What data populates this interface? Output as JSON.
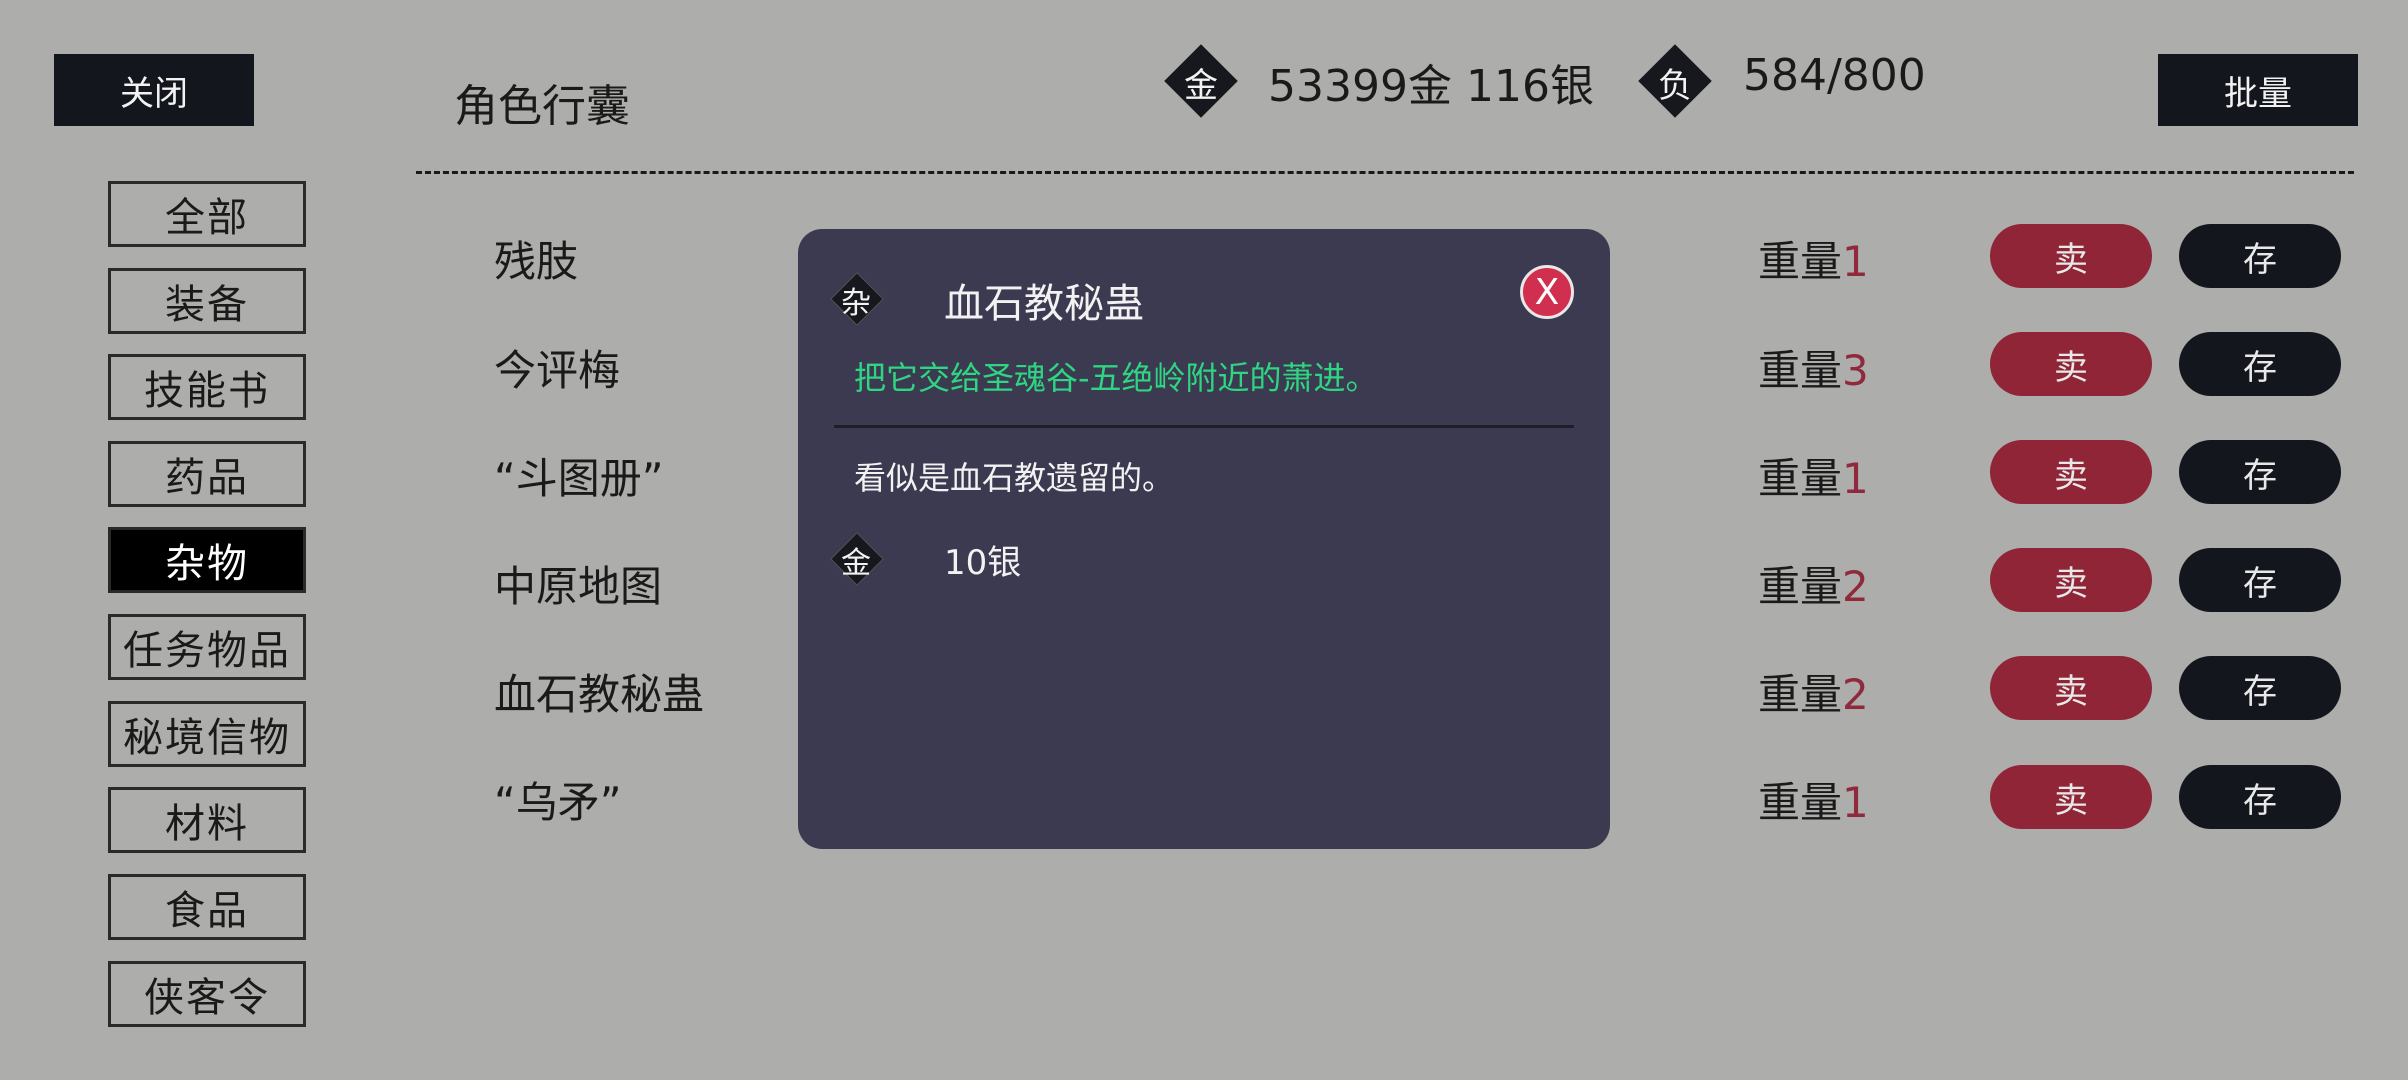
{
  "header": {
    "close_label": "关闭",
    "title": "角色行囊",
    "money_icon": "金",
    "money": "53399金 116银",
    "weight_icon": "负",
    "weight": "584/800",
    "batch_label": "批量"
  },
  "categories": [
    {
      "label": "全部",
      "active": false
    },
    {
      "label": "装备",
      "active": false
    },
    {
      "label": "技能书",
      "active": false
    },
    {
      "label": "药品",
      "active": false
    },
    {
      "label": "杂物",
      "active": true
    },
    {
      "label": "任务物品",
      "active": false
    },
    {
      "label": "秘境信物",
      "active": false
    },
    {
      "label": "材料",
      "active": false
    },
    {
      "label": "食品",
      "active": false
    },
    {
      "label": "侠客令",
      "active": false
    }
  ],
  "items": [
    {
      "name": "残肢",
      "weight_label": "重量",
      "weight": "1",
      "sell": "卖",
      "store": "存"
    },
    {
      "name": "今评梅",
      "weight_label": "重量",
      "weight": "3",
      "sell": "卖",
      "store": "存"
    },
    {
      "name": "“斗图册”",
      "weight_label": "重量",
      "weight": "1",
      "sell": "卖",
      "store": "存"
    },
    {
      "name": "中原地图",
      "weight_label": "重量",
      "weight": "2",
      "sell": "卖",
      "store": "存"
    },
    {
      "name": "血石教秘蛊",
      "weight_label": "重量",
      "weight": "2",
      "sell": "卖",
      "store": "存"
    },
    {
      "name": "“乌矛”",
      "weight_label": "重量",
      "weight": "1",
      "sell": "卖",
      "store": "存"
    }
  ],
  "modal": {
    "type_icon": "杂",
    "title": "血石教秘蛊",
    "close_label": "X",
    "hint": "把它交给圣魂谷-五绝岭附近的萧进。",
    "description": "看似是血石教遗留的。",
    "price_icon": "金",
    "price": "10银"
  },
  "colors": {
    "background": "#adadab",
    "dark": "#14161e",
    "sell": "#912538",
    "weight_number": "#8e2a3c",
    "modal_bg": "#3c3a50",
    "hint_green": "#2ed582",
    "close_red": "#d02f4f"
  }
}
